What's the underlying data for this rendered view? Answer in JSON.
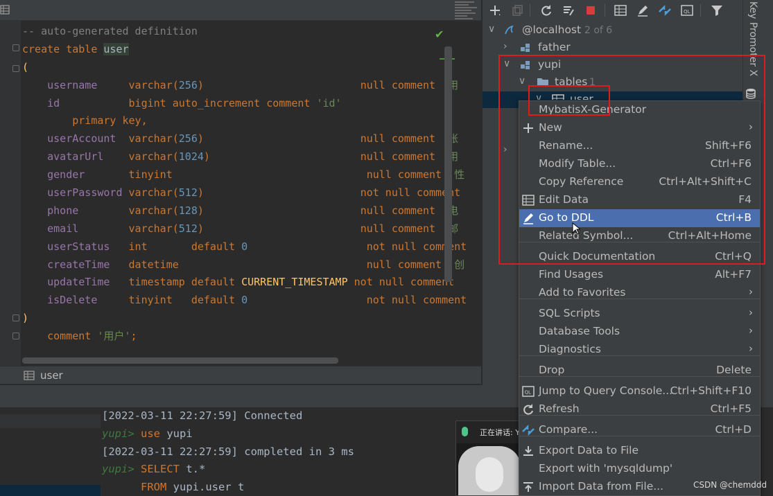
{
  "editor": {
    "lines": [
      [
        {
          "t": "-- auto-generated definition",
          "c": "cm"
        }
      ],
      [
        {
          "t": "create table ",
          "c": "kw"
        },
        {
          "t": "user",
          "c": "tbl"
        }
      ],
      [
        {
          "t": "(",
          "c": "hl"
        }
      ],
      [
        {
          "t": "    username     ",
          "c": "id"
        },
        {
          "t": "varchar(",
          "c": "fn"
        },
        {
          "t": "256",
          "c": "nu"
        },
        {
          "t": ")                         ",
          "c": "fn"
        },
        {
          "t": "null comment ",
          "c": "kw"
        },
        {
          "t": "'用",
          "c": "st"
        }
      ],
      [
        {
          "t": "    id           ",
          "c": "id"
        },
        {
          "t": "bigint auto_increment comment ",
          "c": "kw"
        },
        {
          "t": "'id'",
          "c": "st"
        }
      ],
      [
        {
          "t": "        primary key",
          "c": "kw"
        },
        {
          "t": ",",
          "c": "pu"
        }
      ],
      [
        {
          "t": "    userAccount  ",
          "c": "id"
        },
        {
          "t": "varchar(",
          "c": "fn"
        },
        {
          "t": "256",
          "c": "nu"
        },
        {
          "t": ")                         ",
          "c": "fn"
        },
        {
          "t": "null comment ",
          "c": "kw"
        },
        {
          "t": "'账",
          "c": "st"
        }
      ],
      [
        {
          "t": "    avatarUrl    ",
          "c": "id"
        },
        {
          "t": "varchar(",
          "c": "fn"
        },
        {
          "t": "1024",
          "c": "nu"
        },
        {
          "t": ")                        ",
          "c": "fn"
        },
        {
          "t": "null comment ",
          "c": "kw"
        },
        {
          "t": "'用",
          "c": "st"
        }
      ],
      [
        {
          "t": "    gender       ",
          "c": "id"
        },
        {
          "t": "tinyint                               ",
          "c": "fn"
        },
        {
          "t": "null comment ",
          "c": "kw"
        },
        {
          "t": "'性",
          "c": "st"
        }
      ],
      [
        {
          "t": "    userPassword ",
          "c": "id"
        },
        {
          "t": "varchar(",
          "c": "fn"
        },
        {
          "t": "512",
          "c": "nu"
        },
        {
          "t": ")                         ",
          "c": "fn"
        },
        {
          "t": "not null comment",
          "c": "kw"
        }
      ],
      [
        {
          "t": "    phone        ",
          "c": "id"
        },
        {
          "t": "varchar(",
          "c": "fn"
        },
        {
          "t": "128",
          "c": "nu"
        },
        {
          "t": ")                         ",
          "c": "fn"
        },
        {
          "t": "null comment ",
          "c": "kw"
        },
        {
          "t": "'电",
          "c": "st"
        }
      ],
      [
        {
          "t": "    email        ",
          "c": "id"
        },
        {
          "t": "varchar(",
          "c": "fn"
        },
        {
          "t": "512",
          "c": "nu"
        },
        {
          "t": ")                         ",
          "c": "fn"
        },
        {
          "t": "null comment ",
          "c": "kw"
        },
        {
          "t": "'邮",
          "c": "st"
        }
      ],
      [
        {
          "t": "    userStatus   ",
          "c": "id"
        },
        {
          "t": "int       default ",
          "c": "kw"
        },
        {
          "t": "0",
          "c": "nu"
        },
        {
          "t": "                   ",
          "c": "tx"
        },
        {
          "t": "not null comment",
          "c": "kw"
        }
      ],
      [
        {
          "t": "    createTime   ",
          "c": "id"
        },
        {
          "t": "datetime                              ",
          "c": "kw"
        },
        {
          "t": "null comment ",
          "c": "kw"
        },
        {
          "t": "'创",
          "c": "st"
        }
      ],
      [
        {
          "t": "    updateTime   ",
          "c": "id"
        },
        {
          "t": "timestamp default ",
          "c": "kw"
        },
        {
          "t": "CURRENT_TIMESTAMP",
          "c": "hl"
        },
        {
          "t": " ",
          "c": "tx"
        },
        {
          "t": "not null comment",
          "c": "kw"
        }
      ],
      [
        {
          "t": "    isDelete     ",
          "c": "id"
        },
        {
          "t": "tinyint   default ",
          "c": "kw"
        },
        {
          "t": "0",
          "c": "nu"
        },
        {
          "t": "                   ",
          "c": "tx"
        },
        {
          "t": "not null comment",
          "c": "kw"
        }
      ],
      [
        {
          "t": ")",
          "c": "hl"
        }
      ],
      [
        {
          "t": "    comment ",
          "c": "kw"
        },
        {
          "t": "'用户'",
          "c": "st"
        },
        {
          "t": ";",
          "c": "pu"
        }
      ]
    ]
  },
  "editor_tab": {
    "label": "user"
  },
  "db_tree": {
    "root": {
      "label": "@localhost",
      "count": "2 of 6"
    },
    "father": "father",
    "yupi": "yupi",
    "tables": {
      "label": "tables",
      "count": "1"
    },
    "user_row": "user"
  },
  "side_strip": {
    "label": "Key Promoter X"
  },
  "context_menu": {
    "items": [
      {
        "label": "MybatisX-Generator",
        "shortcut": "",
        "icon": "none",
        "submenu": false
      },
      {
        "label": "New",
        "shortcut": "",
        "icon": "plus-icon",
        "submenu": true
      },
      {
        "label": "Rename...",
        "shortcut": "Shift+F6",
        "icon": "none",
        "submenu": false
      },
      {
        "label": "Modify Table...",
        "shortcut": "Ctrl+F6",
        "icon": "none",
        "submenu": false
      },
      {
        "label": "Copy Reference",
        "shortcut": "Ctrl+Alt+Shift+C",
        "icon": "none",
        "submenu": false
      },
      {
        "label": "Edit Data",
        "shortcut": "F4",
        "icon": "table-grid-icon",
        "submenu": false
      },
      {
        "label": "Go to DDL",
        "shortcut": "Ctrl+B",
        "icon": "pencil-icon",
        "submenu": false,
        "active": true
      },
      {
        "label": "Related Symbol...",
        "shortcut": "Ctrl+Alt+Home",
        "icon": "none",
        "submenu": false
      },
      {
        "label": "Quick Documentation",
        "shortcut": "Ctrl+Q",
        "icon": "none",
        "submenu": false
      },
      {
        "label": "Find Usages",
        "shortcut": "Alt+F7",
        "icon": "none",
        "submenu": false
      },
      {
        "label": "Add to Favorites",
        "shortcut": "",
        "icon": "none",
        "submenu": true
      },
      {
        "label": "SQL Scripts",
        "shortcut": "",
        "icon": "none",
        "submenu": true
      },
      {
        "label": "Database Tools",
        "shortcut": "",
        "icon": "none",
        "submenu": true
      },
      {
        "label": "Diagnostics",
        "shortcut": "",
        "icon": "none",
        "submenu": true
      },
      {
        "label": "Drop",
        "shortcut": "Delete",
        "icon": "none",
        "submenu": false
      },
      {
        "label": "Jump to Query Console...",
        "shortcut": "Ctrl+Shift+F10",
        "icon": "ql-icon",
        "submenu": false
      },
      {
        "label": "Refresh",
        "shortcut": "Ctrl+F5",
        "icon": "refresh-icon",
        "submenu": false
      },
      {
        "label": "Compare...",
        "shortcut": "Ctrl+D",
        "icon": "compare-icon",
        "submenu": false
      },
      {
        "label": "Export Data to File",
        "shortcut": "",
        "icon": "export-icon",
        "submenu": false
      },
      {
        "label": "Export with 'mysqldump'",
        "shortcut": "",
        "icon": "none",
        "submenu": false
      },
      {
        "label": "Import Data from File...",
        "shortcut": "",
        "icon": "import-icon",
        "submenu": false
      }
    ]
  },
  "console": {
    "lines": [
      [
        {
          "t": "[2022-03-11 22:27:59] Connected",
          "c": "tx"
        }
      ],
      [
        {
          "t": "yupi> ",
          "c": "prompt"
        },
        {
          "t": "use ",
          "c": "ck"
        },
        {
          "t": "yupi",
          "c": "tx"
        }
      ],
      [
        {
          "t": "[2022-03-11 22:27:59] completed in 3 ms",
          "c": "tx"
        }
      ],
      [
        {
          "t": "yupi> ",
          "c": "prompt"
        },
        {
          "t": "SELECT ",
          "c": "ck"
        },
        {
          "t": "t.*",
          "c": "tx"
        }
      ],
      [
        {
          "t": "      FROM ",
          "c": "ck"
        },
        {
          "t": "yupi.user t",
          "c": "tx"
        }
      ]
    ]
  },
  "video_overlay": {
    "speaking_label": "正在讲话: Y"
  },
  "watermark": "CSDN @chemddd",
  "colors": {
    "menu_highlight": "#4b6eaf",
    "annotation_red": "#e01b1b",
    "editor_bg": "#2b2b2b",
    "panel_bg": "#3c3f41"
  }
}
